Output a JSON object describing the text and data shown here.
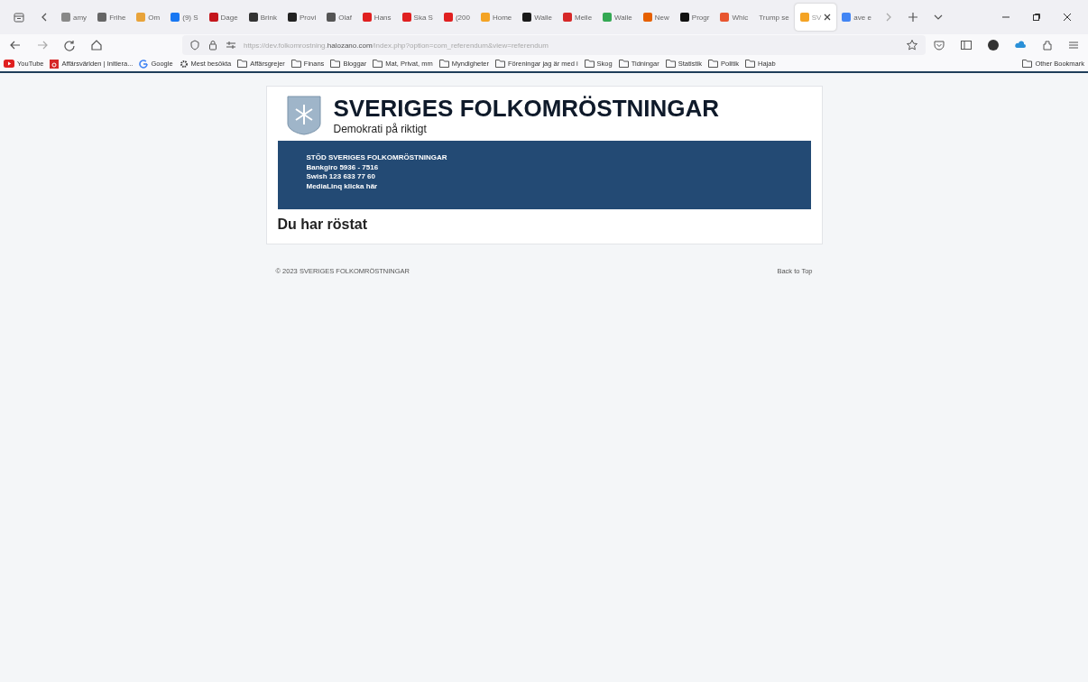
{
  "browser": {
    "tabs": [
      {
        "label": "amy",
        "color": "#888888",
        "selected": false
      },
      {
        "label": "Frihe",
        "color": "#666666",
        "selected": false
      },
      {
        "label": "Om",
        "color": "#e8a33a",
        "selected": false
      },
      {
        "label": "(9) S",
        "color": "#1877f2",
        "selected": false
      },
      {
        "label": "Dage",
        "color": "#c4161c",
        "selected": false
      },
      {
        "label": "Brink",
        "color": "#333333",
        "selected": false
      },
      {
        "label": "Provi",
        "color": "#222222",
        "selected": false
      },
      {
        "label": "Olaf",
        "color": "#555555",
        "selected": false
      },
      {
        "label": "Hans",
        "color": "#e02020",
        "selected": false
      },
      {
        "label": "Ska S",
        "color": "#e02020",
        "selected": false
      },
      {
        "label": "(200",
        "color": "#e02020",
        "selected": false
      },
      {
        "label": "Home",
        "color": "#f4a324",
        "selected": false
      },
      {
        "label": "Walle",
        "color": "#1a1a1a",
        "selected": false
      },
      {
        "label": "Melle",
        "color": "#d62828",
        "selected": false
      },
      {
        "label": "Walle",
        "color": "#34a853",
        "selected": false
      },
      {
        "label": "New",
        "color": "#e66000",
        "selected": false
      },
      {
        "label": "Progr",
        "color": "#111111",
        "selected": false
      },
      {
        "label": "Whic",
        "color": "#e8552f",
        "selected": false
      },
      {
        "label": "Trump se",
        "selected": false
      },
      {
        "label": "SV",
        "color": "#f4a324",
        "selected": true
      },
      {
        "label": "ave e",
        "color": "#4285f4",
        "selected": false
      }
    ],
    "url_prefix": "https://dev.folkomrostning.",
    "url_domain": "halozano.com",
    "url_suffix": "/index.php?option=com_referendum&view=referendum",
    "bookmarks": [
      {
        "label": "YouTube",
        "kind": "youtube"
      },
      {
        "label": "Affärsvärlden | Initiera...",
        "kind": "site"
      },
      {
        "label": "Google",
        "kind": "google"
      },
      {
        "label": "Mest besökta",
        "kind": "gear"
      },
      {
        "label": "Affärsgrejer",
        "kind": "folder"
      },
      {
        "label": "Finans",
        "kind": "folder"
      },
      {
        "label": "Bloggar",
        "kind": "folder"
      },
      {
        "label": "Mat, Privat, mm",
        "kind": "folder"
      },
      {
        "label": "Myndigheter",
        "kind": "folder"
      },
      {
        "label": "Föreningar jag är med i",
        "kind": "folder"
      },
      {
        "label": "Skog",
        "kind": "folder"
      },
      {
        "label": "Tidningar",
        "kind": "folder"
      },
      {
        "label": "Statistik",
        "kind": "folder"
      },
      {
        "label": "Politik",
        "kind": "folder"
      },
      {
        "label": "Hajab",
        "kind": "folder"
      }
    ],
    "other_bookmarks": "Other Bookmark"
  },
  "page": {
    "title": "SVERIGES FOLKOMRÖSTNINGAR",
    "tagline": "Demokrati på riktigt",
    "banner_lines": [
      "STÖD SVERIGES FOLKOMRÖSTNINGAR",
      "Bankgiro 5936 - 7516",
      "Swish 123 633 77 60",
      "MediaLinq klicka här"
    ],
    "heading": "Du har röstat",
    "footer": {
      "copyright": "© 2023 SVERIGES FOLKOMRÖSTNINGAR",
      "back_to_top": "Back to Top"
    }
  }
}
